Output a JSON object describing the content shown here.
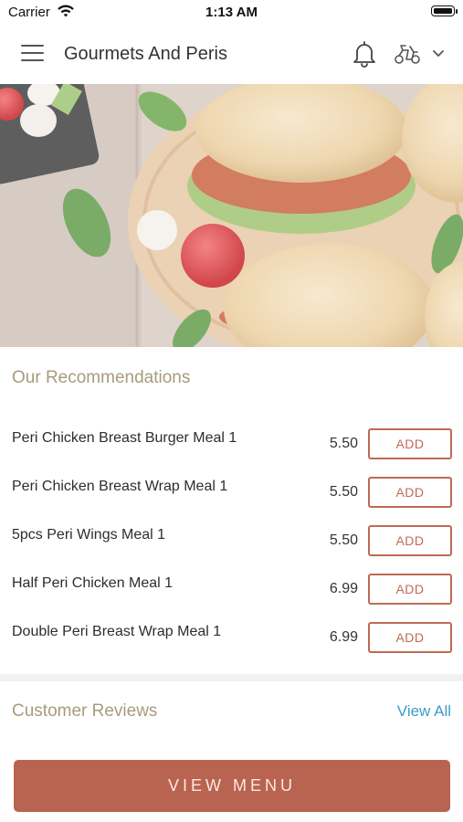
{
  "status_bar": {
    "carrier": "Carrier",
    "time": "1:13 AM"
  },
  "header": {
    "title": "Gourmets And Peris",
    "icons": [
      "menu-icon",
      "bell-icon",
      "scooter-icon",
      "chevron-down-icon"
    ]
  },
  "recommendations": {
    "title": "Our Recommendations",
    "items": [
      {
        "name": "Peri Chicken Breast Burger Meal 1",
        "price": "5.50",
        "button": "ADD"
      },
      {
        "name": "Peri Chicken Breast Wrap Meal 1",
        "price": "5.50",
        "button": "ADD"
      },
      {
        "name": "5pcs Peri Wings Meal 1",
        "price": "5.50",
        "button": "ADD"
      },
      {
        "name": "Half Peri Chicken Meal 1",
        "price": "6.99",
        "button": "ADD"
      },
      {
        "name": "Double Peri Breast Wrap Meal 1",
        "price": "6.99",
        "button": "ADD"
      }
    ]
  },
  "reviews": {
    "title": "Customer Reviews",
    "view_all": "View All"
  },
  "footer": {
    "view_menu": "VIEW MENU"
  },
  "colors": {
    "accent": "#b96450",
    "section_title": "#a89b7c",
    "link": "#3c9cc9"
  }
}
